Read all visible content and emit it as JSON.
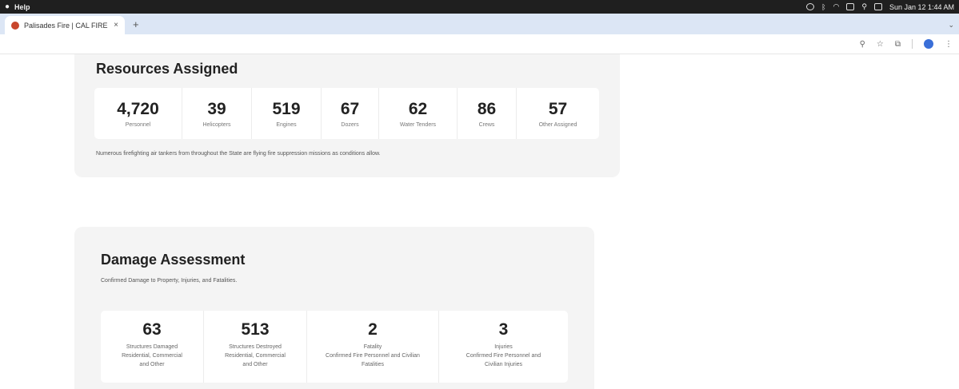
{
  "menubar": {
    "menu": "Help",
    "datetime": "Sun Jan 12  1:44 AM"
  },
  "tab": {
    "title": "Palisades Fire | CAL FIRE",
    "close": "×",
    "new": "+"
  },
  "icons": {
    "zoom": "magnifier-icon",
    "bookmark": "star-icon",
    "extensions": "puzzle-icon",
    "profile": "avatar-icon",
    "menu": "kebab-menu-icon"
  },
  "resources": {
    "title": "Resources Assigned",
    "items": [
      {
        "value": "4,720",
        "label": "Personnel"
      },
      {
        "value": "39",
        "label": "Helicopters"
      },
      {
        "value": "519",
        "label": "Engines"
      },
      {
        "value": "67",
        "label": "Dozers"
      },
      {
        "value": "62",
        "label": "Water Tenders"
      },
      {
        "value": "86",
        "label": "Crews"
      },
      {
        "value": "57",
        "label": "Other Assigned"
      }
    ],
    "note": "Numerous firefighting air tankers from throughout the State are flying fire suppression missions as conditions allow."
  },
  "damage": {
    "title": "Damage Assessment",
    "subtitle": "Confirmed Damage to Property, Injuries, and Fatalities.",
    "items": [
      {
        "value": "63",
        "lines": [
          "Structures Damaged",
          "Residential, Commercial",
          "and Other"
        ]
      },
      {
        "value": "513",
        "lines": [
          "Structures Destroyed",
          "Residential, Commercial",
          "and Other"
        ]
      },
      {
        "value": "2",
        "lines": [
          "Fatality",
          "Confirmed Fire Personnel and Civilian",
          "Fatalities"
        ]
      },
      {
        "value": "3",
        "lines": [
          "Injuries",
          "Confirmed Fire Personnel and",
          "Civilian Injuries"
        ]
      }
    ]
  },
  "colors": {
    "card_bg": "#f4f4f4",
    "tab_strip": "#dce6f5",
    "favicon": "#c8462c"
  }
}
